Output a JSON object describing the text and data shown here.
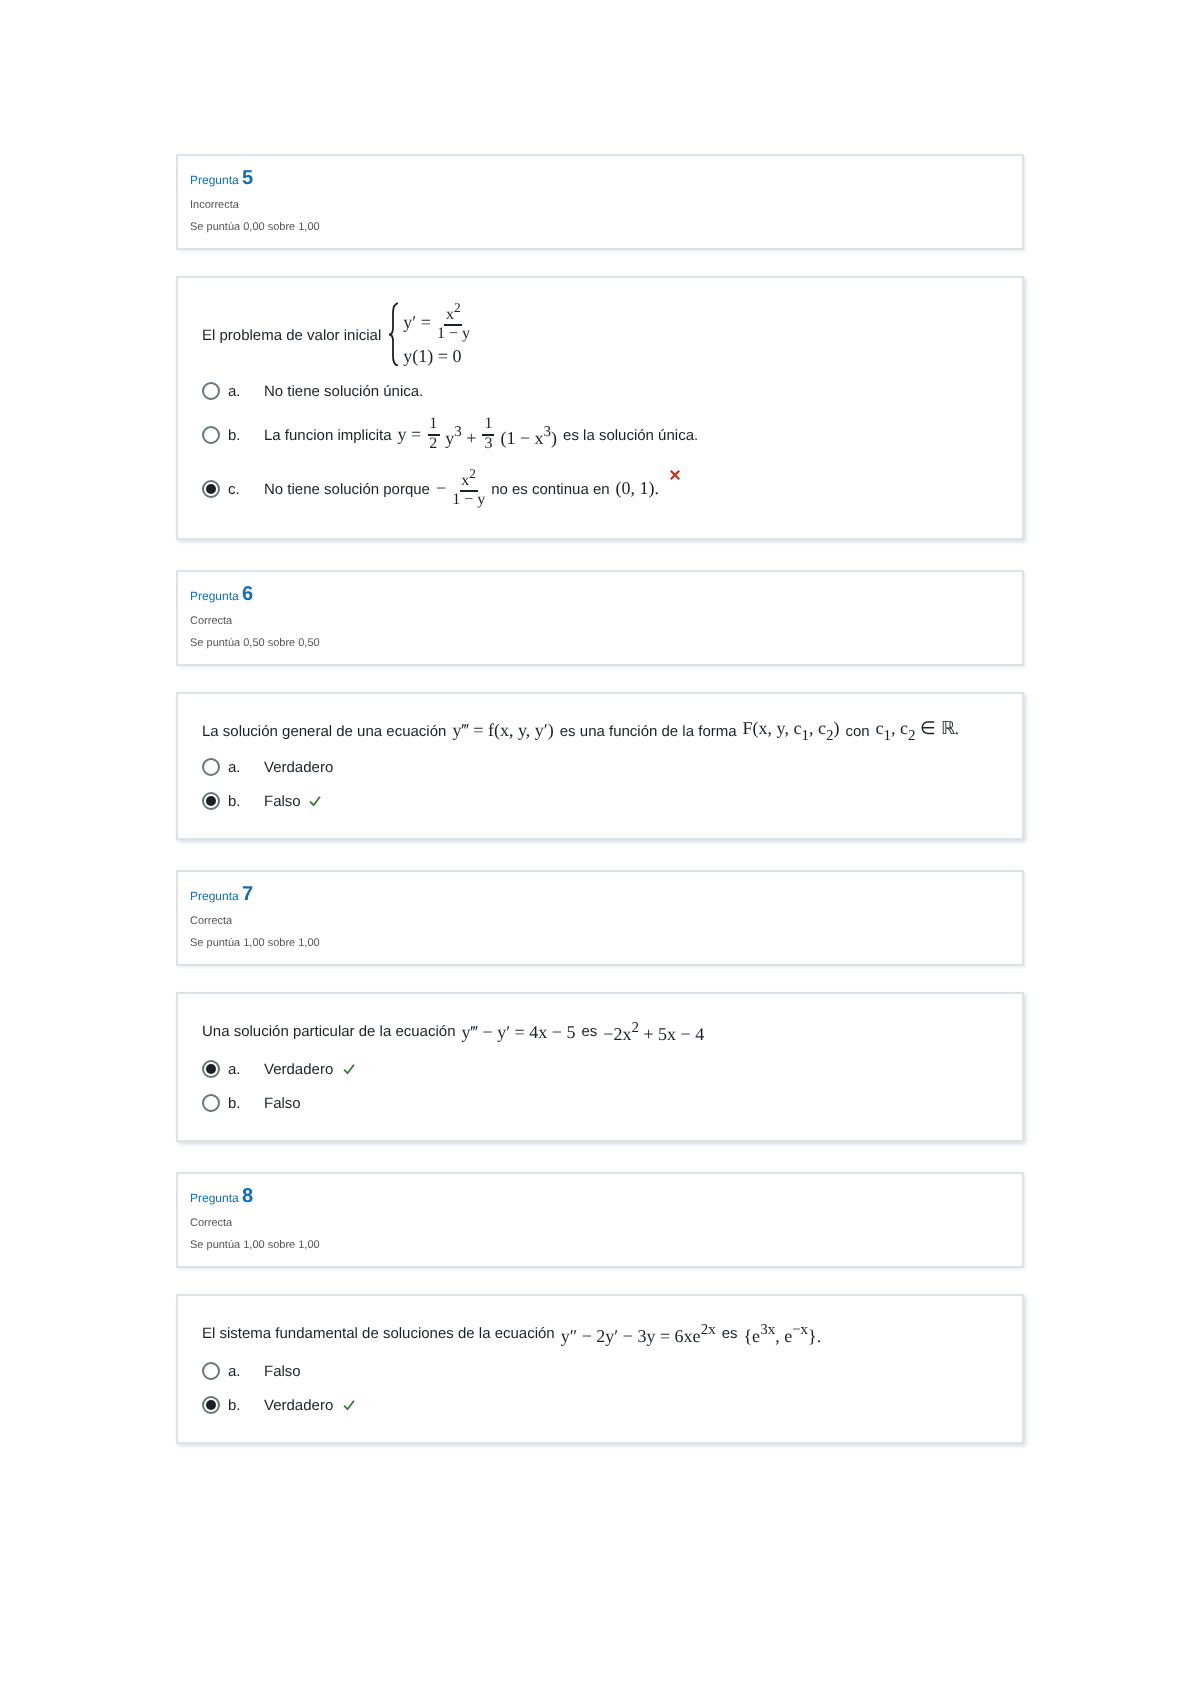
{
  "questions": [
    {
      "label": "Pregunta",
      "number": "5",
      "status": "Incorrecta",
      "score": "Se puntúa 0,00 sobre 1,00",
      "prompt": [
        {
          "kind": "text",
          "t": "El problema de valor inicial"
        },
        {
          "kind": "system",
          "rows": [
            [
              {
                "kind": "math",
                "t": "y′ ="
              },
              {
                "kind": "frac",
                "num": "x$^{2}$",
                "den": "1 − y"
              }
            ],
            [
              {
                "kind": "math",
                "t": "y(1) = 0"
              }
            ]
          ]
        }
      ],
      "options": [
        {
          "letter": "a.",
          "selected": false,
          "correct": false,
          "incorrect": false,
          "parts": [
            {
              "kind": "text",
              "t": "No tiene solución única."
            }
          ]
        },
        {
          "letter": "b.",
          "selected": false,
          "correct": false,
          "incorrect": false,
          "parts": [
            {
              "kind": "text",
              "t": "La funcion implicita"
            },
            {
              "kind": "math",
              "t": "y ="
            },
            {
              "kind": "frac",
              "num": "1",
              "den": "2"
            },
            {
              "kind": "math",
              "t": "y$^{3}$ +"
            },
            {
              "kind": "frac",
              "num": "1",
              "den": "3"
            },
            {
              "kind": "math",
              "t": "(1 − x$^{3}$)"
            },
            {
              "kind": "text",
              "t": "es la solución única."
            }
          ]
        },
        {
          "letter": "c.",
          "selected": true,
          "correct": false,
          "incorrect": true,
          "parts": [
            {
              "kind": "text",
              "t": "No tiene solución porque"
            },
            {
              "kind": "math",
              "t": "−"
            },
            {
              "kind": "frac",
              "num": "x$^{2}$",
              "den": "1 − y"
            },
            {
              "kind": "text",
              "t": "no es continua en"
            },
            {
              "kind": "math",
              "t": "(0, 1)."
            }
          ]
        }
      ]
    },
    {
      "label": "Pregunta",
      "number": "6",
      "status": "Correcta",
      "score": "Se puntúa 0,50 sobre 0,50",
      "prompt": [
        {
          "kind": "text",
          "t": "La solución general de una ecuación"
        },
        {
          "kind": "math",
          "t": "y‴ = f(x, y, y′)"
        },
        {
          "kind": "text",
          "t": "es una función de la forma"
        },
        {
          "kind": "math",
          "t": "F(x, y, c$_{1}$, c$_{2}$)"
        },
        {
          "kind": "text",
          "t": "con"
        },
        {
          "kind": "math",
          "t": "c$_{1}$, c$_{2}$ ∈ ℝ."
        }
      ],
      "options": [
        {
          "letter": "a.",
          "selected": false,
          "correct": false,
          "incorrect": false,
          "parts": [
            {
              "kind": "text",
              "t": "Verdadero"
            }
          ]
        },
        {
          "letter": "b.",
          "selected": true,
          "correct": true,
          "incorrect": false,
          "parts": [
            {
              "kind": "text",
              "t": "Falso"
            }
          ]
        }
      ]
    },
    {
      "label": "Pregunta",
      "number": "7",
      "status": "Correcta",
      "score": "Se puntúa 1,00 sobre 1,00",
      "prompt": [
        {
          "kind": "text",
          "t": "Una solución particular de la ecuación"
        },
        {
          "kind": "math",
          "t": "y‴ − y′ = 4x − 5"
        },
        {
          "kind": "text",
          "t": "es"
        },
        {
          "kind": "math",
          "t": "−2x$^{2}$ + 5x − 4"
        }
      ],
      "options": [
        {
          "letter": "a.",
          "selected": true,
          "correct": true,
          "incorrect": false,
          "parts": [
            {
              "kind": "text",
              "t": "Verdadero"
            }
          ]
        },
        {
          "letter": "b.",
          "selected": false,
          "correct": false,
          "incorrect": false,
          "parts": [
            {
              "kind": "text",
              "t": "Falso"
            }
          ]
        }
      ]
    },
    {
      "label": "Pregunta",
      "number": "8",
      "status": "Correcta",
      "score": "Se puntúa 1,00 sobre 1,00",
      "prompt": [
        {
          "kind": "text",
          "t": "El sistema fundamental de soluciones de la ecuación"
        },
        {
          "kind": "math",
          "t": "y″ − 2y′ − 3y = 6xe$^{2x}$"
        },
        {
          "kind": "text",
          "t": "es"
        },
        {
          "kind": "math",
          "t": "{e$^{3x}$, e$^{−x}$}."
        }
      ],
      "options": [
        {
          "letter": "a.",
          "selected": false,
          "correct": false,
          "incorrect": false,
          "parts": [
            {
              "kind": "text",
              "t": "Falso"
            }
          ]
        },
        {
          "letter": "b.",
          "selected": true,
          "correct": true,
          "incorrect": false,
          "parts": [
            {
              "kind": "text",
              "t": "Verdadero"
            }
          ]
        }
      ]
    }
  ]
}
